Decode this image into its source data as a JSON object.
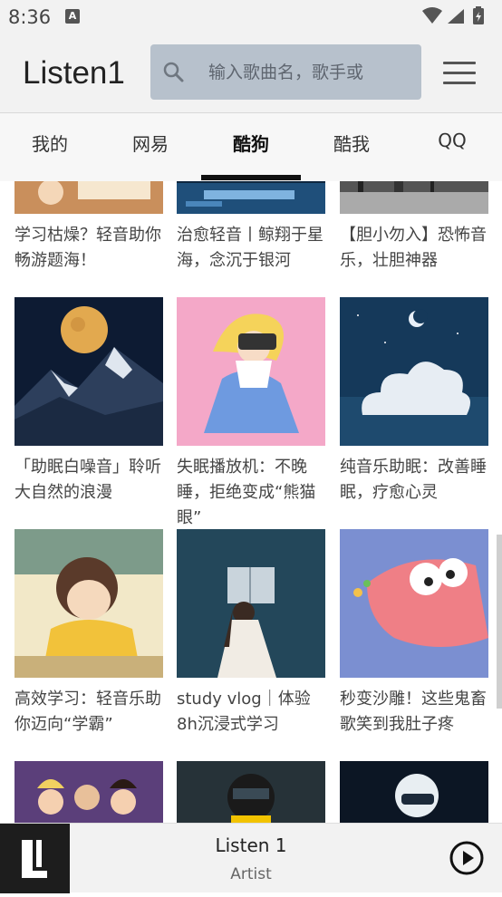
{
  "status": {
    "time": "8:36",
    "notif_icon": "A"
  },
  "appbar": {
    "title": "Listen1",
    "search_placeholder": "输入歌曲名，歌手或"
  },
  "tabs": [
    {
      "label": "我的"
    },
    {
      "label": "网易"
    },
    {
      "label": "酷狗"
    },
    {
      "label": "酷我"
    },
    {
      "label": "QQ"
    }
  ],
  "active_tab": "酷狗",
  "playlists": [
    {
      "title": "学习枯燥？轻音助你畅游题海！",
      "art": "study-desk-illustration"
    },
    {
      "title": "治愈轻音丨鲸翔于星海，念沉于银河",
      "art": "night-city-blue"
    },
    {
      "title": "【胆小勿入】恐怖音乐，壮胆神器",
      "art": "dark-forest-bw"
    },
    {
      "title": "「助眠白噪音」聆听大自然的浪漫",
      "art": "moon-over-mountains"
    },
    {
      "title": "失眠播放机：不晚睡，拒绝变成“熊猫眼”",
      "art": "vr-girl-pink"
    },
    {
      "title": "纯音乐助眠：改善睡眠，疗愈心灵",
      "art": "cloud-moon-night"
    },
    {
      "title": "高效学习：轻音乐助你迈向“学霸”",
      "art": "boy-studying-anime"
    },
    {
      "title": "study vlog｜体验8h沉浸式学习",
      "art": "girl-reading-book"
    },
    {
      "title": "秒变沙雕！这些鬼畜歌笑到我肚子疼",
      "art": "patrick-cartoon"
    },
    {
      "title": "",
      "art": "princesses-cartoon"
    },
    {
      "title": "",
      "art": "helmet-motorcycle"
    },
    {
      "title": "",
      "art": "astronaut-dark"
    }
  ],
  "player": {
    "song": "Listen 1",
    "artist": "Artist",
    "logo": "L"
  },
  "colors": {
    "search_bg": "#b7c1cc",
    "appbar_bg": "#f2f2f2",
    "logo_bg": "#1d1d1d"
  }
}
